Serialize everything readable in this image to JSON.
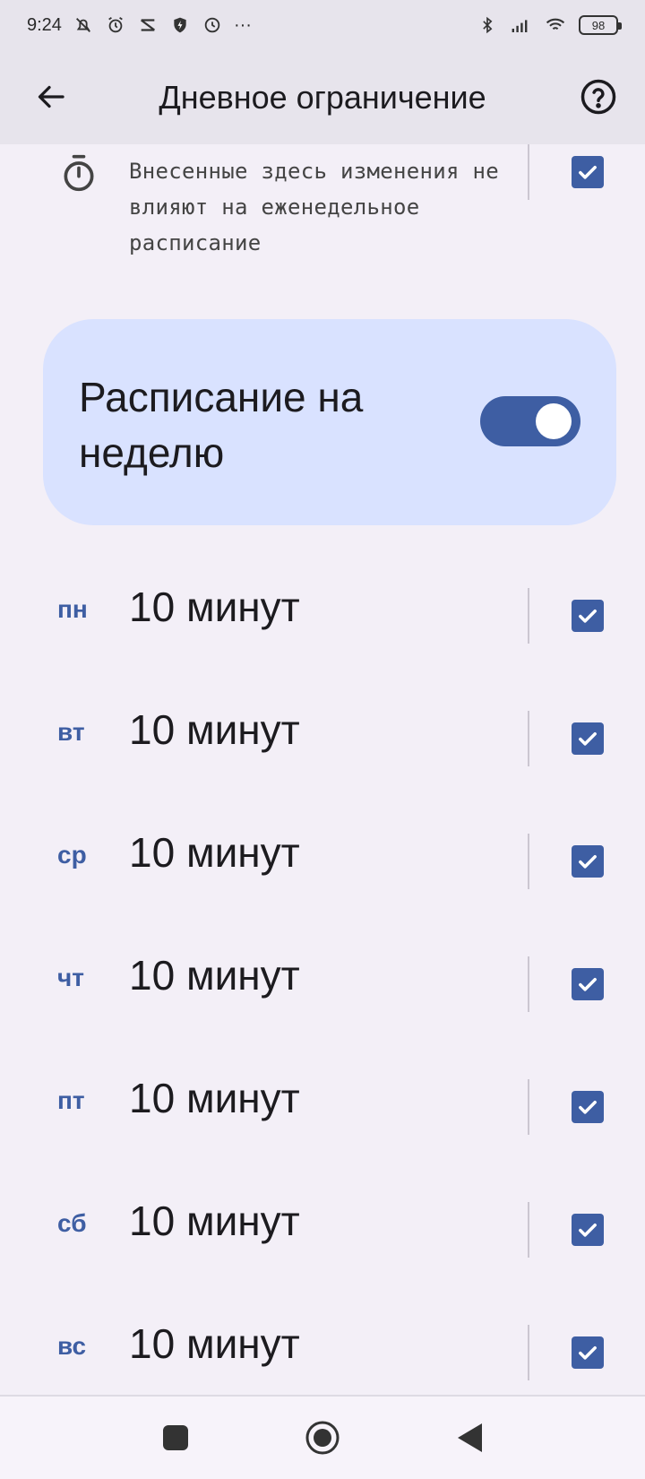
{
  "status_bar": {
    "time": "9:24",
    "ellipsis": "···",
    "battery": "98"
  },
  "app_bar": {
    "title": "Дневное ограничение"
  },
  "info": {
    "text": "Внесенные здесь изменения не влияют на еженедельное расписание"
  },
  "weekly_schedule": {
    "label": "Расписание на неделю",
    "enabled": true
  },
  "days": [
    {
      "abbr": "пн",
      "value": "10 минут",
      "checked": true
    },
    {
      "abbr": "вт",
      "value": "10 минут",
      "checked": true
    },
    {
      "abbr": "ср",
      "value": "10 минут",
      "checked": true
    },
    {
      "abbr": "чт",
      "value": "10 минут",
      "checked": true
    },
    {
      "abbr": "пт",
      "value": "10 минут",
      "checked": true
    },
    {
      "abbr": "сб",
      "value": "10 минут",
      "checked": true
    },
    {
      "abbr": "вс",
      "value": "10 минут",
      "checked": true
    }
  ],
  "colors": {
    "accent": "#3e5ea3",
    "card": "#d9e2ff",
    "background": "#f3eff7",
    "app_bar": "#e7e4ec"
  },
  "icons": {
    "back": "arrow-left-icon",
    "help": "help-circle-icon",
    "timer": "timer-icon",
    "nav_recents": "square-icon",
    "nav_home": "circle-icon",
    "nav_back": "triangle-back-icon"
  }
}
